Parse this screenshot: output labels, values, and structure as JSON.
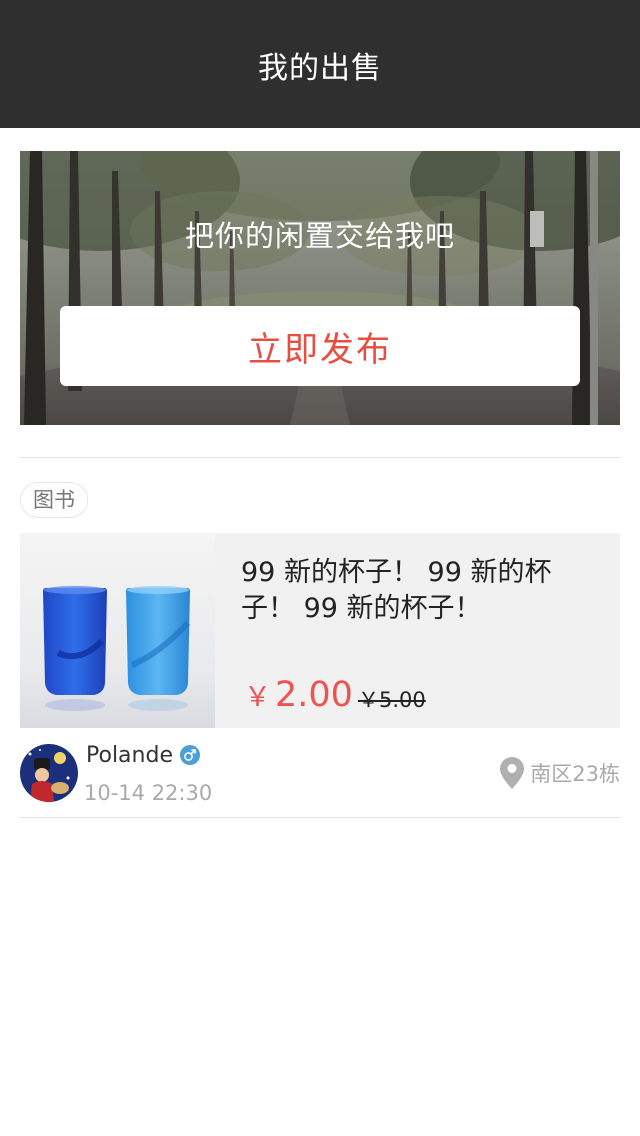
{
  "header": {
    "title": "我的出售"
  },
  "banner": {
    "slogan": "把你的闲置交给我吧",
    "publish_label": "立即发布"
  },
  "category_tag": "图书",
  "listing": {
    "title": "99 新的杯子！ 99 新的杯子！ 99 新的杯子！",
    "price_symbol": "￥",
    "price": "2.00",
    "original_price": "￥5.00"
  },
  "seller": {
    "name": "Polande",
    "gender": "male",
    "posted_time": "10-14 22:30",
    "location": "南区23栋"
  },
  "colors": {
    "header_bg": "#2f2f2f",
    "accent_red": "#e84e3f",
    "price_red": "#ef5350",
    "gender_blue": "#4a9fd8",
    "muted_text": "#aaaaaa"
  },
  "icons": {
    "gender": "male-symbol-icon",
    "location": "location-pin-icon"
  }
}
